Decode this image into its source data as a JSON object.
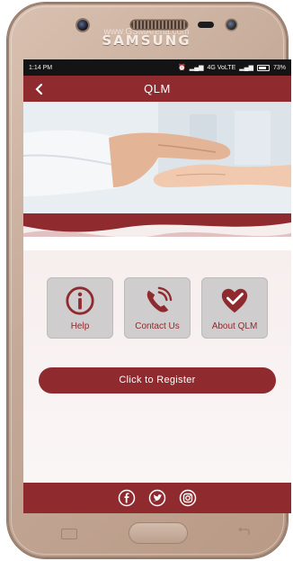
{
  "device": {
    "brand": "SAMSUNG",
    "watermark": "www.GSMArena.com"
  },
  "status_bar": {
    "time": "1:14 PM",
    "network": "4G VoLTE",
    "battery": "73%"
  },
  "app_bar": {
    "title": "QLM"
  },
  "tiles": [
    {
      "label": "Help",
      "icon": "info-icon"
    },
    {
      "label": "Contact Us",
      "icon": "phone-icon"
    },
    {
      "label": "About QLM",
      "icon": "heart-check-icon"
    }
  ],
  "register": {
    "label": "Click to Register"
  },
  "footer": {
    "social": [
      "facebook-icon",
      "twitter-icon",
      "instagram-icon"
    ]
  },
  "colors": {
    "primary": "#8f2a2e",
    "tile_bg": "#cfcdcd"
  }
}
